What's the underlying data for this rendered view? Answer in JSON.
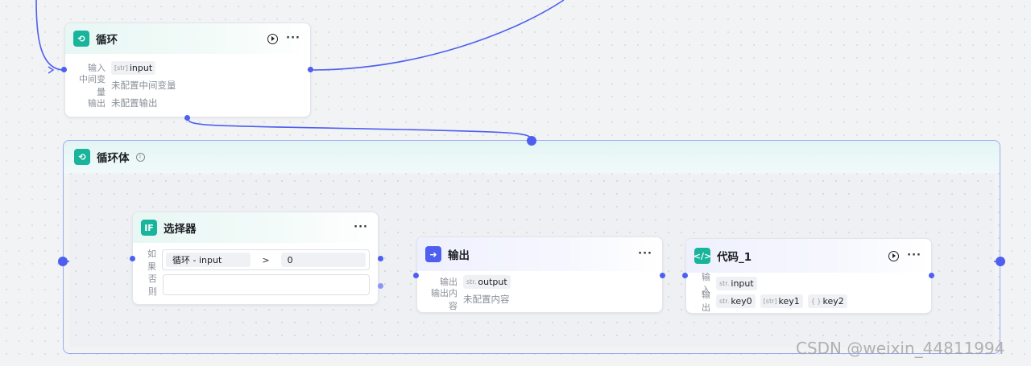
{
  "loop_node": {
    "title": "循环",
    "input_label": "输入",
    "input_type": "[str]",
    "input_value": "input",
    "vars_label": "中间变量",
    "vars_value": "未配置中间变量",
    "output_label": "输出",
    "output_value": "未配置输出"
  },
  "loop_body": {
    "title": "循环体"
  },
  "selector_node": {
    "title": "选择器",
    "icon_text": "IF",
    "if_label": "如果",
    "cond_left": "循环  -  input",
    "cond_op": ">",
    "cond_right": "0",
    "else_label": "否则"
  },
  "output_node": {
    "title": "输出",
    "output_label": "输出",
    "output_type": "str.",
    "output_value": "output",
    "content_label": "输出内容",
    "content_value": "未配置内容"
  },
  "code_node": {
    "title": "代码_1",
    "input_label": "输入",
    "input_type": "str.",
    "input_value": "input",
    "output_label": "输出",
    "outputs": [
      {
        "type": "str.",
        "name": "key0"
      },
      {
        "type": "[str]",
        "name": "key1"
      },
      {
        "type": "{ }",
        "name": "key2"
      }
    ]
  },
  "colors": {
    "accent": "#4e5ff0",
    "teal": "#18b49b",
    "frame": "#9ea8f5"
  },
  "watermark": "CSDN @weixin_44811994"
}
